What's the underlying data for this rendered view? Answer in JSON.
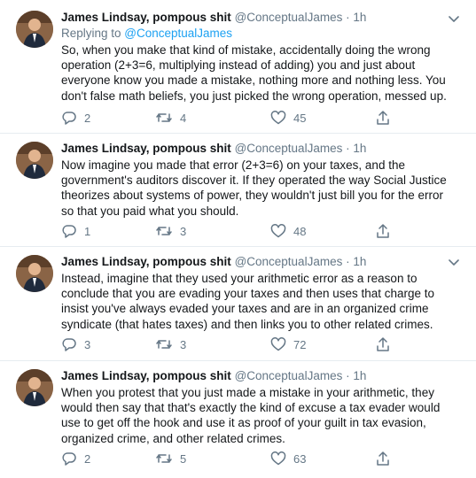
{
  "tweets": [
    {
      "name": "James Lindsay, pompous shit",
      "handle": "@ConceptualJames",
      "separator": "·",
      "time": "1h",
      "replying_prefix": "Replying to ",
      "replying_handle": "@ConceptualJames",
      "text_lines": [
        "So, when you make that kind of mistake, accidentally doing the wrong",
        "operation (2+3=6, multiplying instead of adding) you and just about",
        "everyone know you made a mistake, nothing more and nothing less. You",
        "don't false math beliefs, you just picked the wrong operation, messed up."
      ],
      "replies": "2",
      "retweets": "4",
      "likes": "45"
    },
    {
      "name": "James Lindsay, pompous shit",
      "handle": "@ConceptualJames",
      "separator": "·",
      "time": "1h",
      "text_lines": [
        "Now imagine you made that error (2+3=6) on your taxes, and the",
        "government's auditors discover it. If they operated the way Social Justice",
        "theorizes about systems of power, they wouldn't just bill you for the error",
        "so that you paid what you should."
      ],
      "replies": "1",
      "retweets": "3",
      "likes": "48"
    },
    {
      "name": "James Lindsay, pompous shit",
      "handle": "@ConceptualJames",
      "separator": "·",
      "time": "1h",
      "text_lines": [
        "Instead, imagine that they used your arithmetic error as a reason to",
        "conclude that you are evading your taxes and then uses that charge to",
        "insist you've always evaded your taxes and are in an organized crime",
        "syndicate (that hates taxes) and then links you to other related crimes."
      ],
      "replies": "3",
      "retweets": "3",
      "likes": "72"
    },
    {
      "name": "James Lindsay, pompous shit",
      "handle": "@ConceptualJames",
      "separator": "·",
      "time": "1h",
      "text_lines": [
        "When you protest that you just made a mistake in your arithmetic, they",
        "would then say that that's exactly the kind of excuse a tax evader would",
        "use to get off the hook and use it as proof of your guilt in tax evasion,",
        "organized crime, and other related crimes."
      ],
      "replies": "2",
      "retweets": "5",
      "likes": "63"
    }
  ],
  "colors": {
    "text": "#14171a",
    "secondary": "#657786",
    "link": "#1da1f2",
    "divider": "#e6ecf0"
  },
  "icons": {
    "reply": "reply-icon",
    "retweet": "retweet-icon",
    "like": "heart-icon",
    "share": "share-icon",
    "more": "chevron-down-icon"
  }
}
